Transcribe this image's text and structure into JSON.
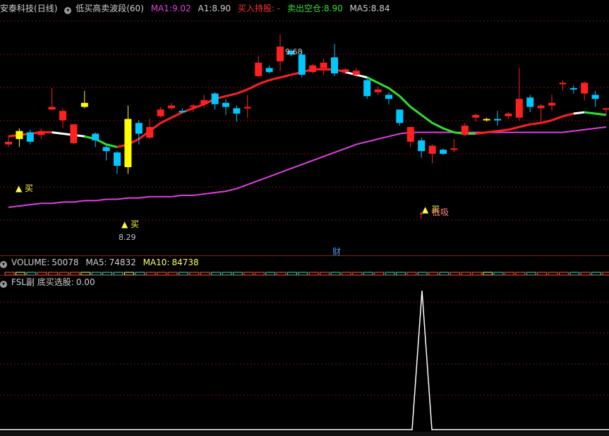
{
  "main": {
    "stock": "安泰科技",
    "period": "(日线)",
    "indicator": "低买高卖波段(60)",
    "ma1_label": "MA1:",
    "ma1_value": "9.02",
    "a1_label": "A1:",
    "a1_value": "8.90",
    "buy_hold": "买入持股: -",
    "sell_label": "卖出空仓:",
    "sell_value": "8.90",
    "ma5_label": "MA5:",
    "ma5_value": "8.84",
    "high_label": "9.68",
    "low_label": "8.29",
    "buy_text": "买",
    "buy_text2": "买",
    "buy_text3": "买",
    "di_xi": "低吸",
    "cai": "财"
  },
  "volume": {
    "label": "VOLUME:",
    "value": "50078",
    "ma5_label": "MA5:",
    "ma5_value": "74832",
    "ma10_label": "MA10:",
    "ma10_value": "84738"
  },
  "sub": {
    "label": "FSL副 底买选股:",
    "value": "0.00"
  },
  "colors": {
    "up": "#ff2020",
    "down": "#00c8ff",
    "buy_signal": "#ffff00",
    "ma_pink": "#e040e0",
    "band_red": "#ff2020",
    "band_green": "#30e030",
    "grid": "#7a1010"
  },
  "chart_data": {
    "type": "candlestick",
    "candles": [
      [
        8.88,
        8.86,
        8.92,
        8.84,
        "up"
      ],
      [
        8.9,
        8.96,
        8.98,
        8.84,
        "buy"
      ],
      [
        8.88,
        8.95,
        8.97,
        8.86,
        "down"
      ],
      [
        8.93,
        8.96,
        8.98,
        8.9,
        "up"
      ],
      [
        9.12,
        9.14,
        9.28,
        9.12,
        "up"
      ],
      [
        9.04,
        9.11,
        9.13,
        8.98,
        "up"
      ],
      [
        9.01,
        8.87,
        9.01,
        8.86,
        "up"
      ],
      [
        9.17,
        9.14,
        9.26,
        9.13,
        "buy"
      ],
      [
        8.94,
        8.89,
        8.95,
        8.84,
        "down"
      ],
      [
        8.84,
        8.81,
        8.86,
        8.74,
        "down"
      ],
      [
        8.8,
        8.7,
        8.81,
        8.64,
        "down"
      ],
      [
        9.05,
        8.69,
        9.15,
        8.64,
        "buy"
      ],
      [
        9.02,
        8.94,
        9.04,
        8.86,
        "down"
      ],
      [
        8.91,
        8.99,
        9.05,
        8.9,
        "up"
      ],
      [
        9.07,
        9.12,
        9.14,
        9.06,
        "up"
      ],
      [
        9.13,
        9.15,
        9.17,
        9.12,
        "up"
      ],
      [
        9.1,
        9.11,
        9.13,
        9.09,
        "down"
      ],
      [
        9.15,
        9.14,
        9.16,
        9.1,
        "up"
      ],
      [
        9.16,
        9.19,
        9.23,
        9.13,
        "up"
      ],
      [
        9.24,
        9.16,
        9.25,
        9.12,
        "down"
      ],
      [
        9.17,
        9.14,
        9.2,
        9.08,
        "down"
      ],
      [
        9.09,
        9.13,
        9.15,
        9.03,
        "down"
      ],
      [
        9.13,
        9.14,
        9.23,
        9.06,
        "up"
      ],
      [
        9.37,
        9.47,
        9.52,
        9.36,
        "up"
      ],
      [
        9.4,
        9.43,
        9.45,
        9.39,
        "down"
      ],
      [
        9.48,
        9.59,
        9.68,
        9.41,
        "up"
      ],
      [
        9.53,
        9.56,
        9.57,
        9.52,
        "down"
      ],
      [
        9.38,
        9.53,
        9.56,
        9.36,
        "down"
      ],
      [
        9.4,
        9.45,
        9.46,
        9.39,
        "up"
      ],
      [
        9.43,
        9.47,
        9.5,
        9.38,
        "up"
      ],
      [
        9.51,
        9.39,
        9.61,
        9.37,
        "down"
      ],
      [
        9.4,
        9.42,
        9.43,
        9.38,
        "up"
      ],
      [
        9.38,
        9.41,
        9.43,
        9.36,
        "up"
      ],
      [
        9.22,
        9.34,
        9.35,
        9.2,
        "down"
      ],
      [
        9.27,
        9.25,
        9.29,
        9.23,
        "up"
      ],
      [
        9.23,
        9.2,
        9.25,
        9.16,
        "down"
      ],
      [
        9.02,
        9.12,
        9.12,
        9.0,
        "down"
      ],
      [
        8.88,
        8.99,
        8.9,
        8.84,
        "up"
      ],
      [
        8.81,
        8.89,
        8.91,
        8.76,
        "down"
      ],
      [
        8.79,
        8.85,
        8.86,
        8.72,
        "up"
      ],
      [
        8.79,
        8.82,
        8.83,
        8.78,
        "down"
      ],
      [
        8.82,
        8.83,
        8.9,
        8.8,
        "up"
      ],
      [
        8.93,
        9.0,
        9.02,
        8.92,
        "up"
      ],
      [
        9.06,
        9.08,
        9.09,
        9.03,
        "up"
      ],
      [
        9.05,
        9.05,
        9.06,
        9.03,
        "buy"
      ],
      [
        9.04,
        9.05,
        9.11,
        9.0,
        "down"
      ],
      [
        9.09,
        9.07,
        9.1,
        9.05,
        "up"
      ],
      [
        9.06,
        9.2,
        9.43,
        9.04,
        "up"
      ],
      [
        9.21,
        9.14,
        9.23,
        9.1,
        "down"
      ],
      [
        9.13,
        9.15,
        9.16,
        9.02,
        "up"
      ],
      [
        9.17,
        9.15,
        9.23,
        9.11,
        "up"
      ],
      [
        9.31,
        9.32,
        9.34,
        9.26,
        "up"
      ],
      [
        9.27,
        9.28,
        9.3,
        9.24,
        "down"
      ],
      [
        9.24,
        9.32,
        9.33,
        9.19,
        "up"
      ],
      [
        9.23,
        9.2,
        9.26,
        9.14,
        "down"
      ],
      [
        9.13,
        9.13,
        9.13,
        9.08,
        "up"
      ]
    ],
    "fsl_spike_x_index": 43
  }
}
